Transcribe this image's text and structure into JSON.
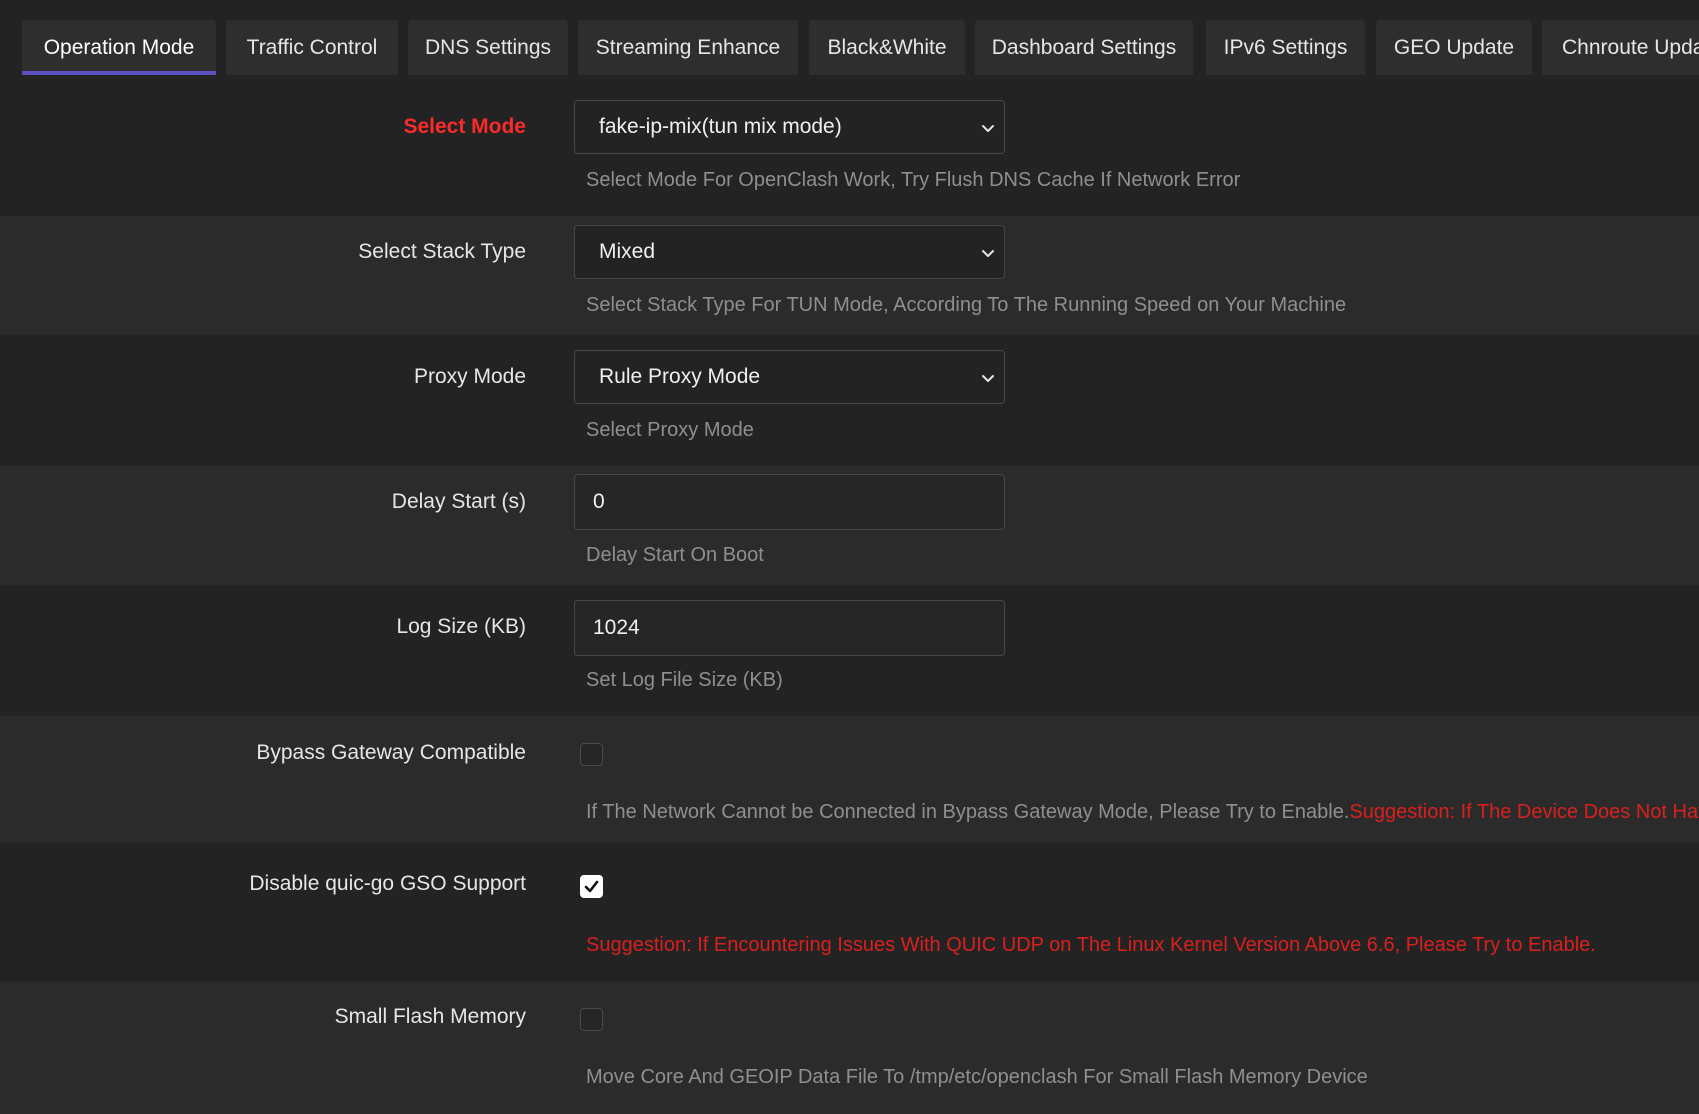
{
  "tabs": [
    {
      "label": "Operation Mode",
      "active": true
    },
    {
      "label": "Traffic Control"
    },
    {
      "label": "DNS Settings"
    },
    {
      "label": "Streaming Enhance"
    },
    {
      "label": "Black&White"
    },
    {
      "label": "Dashboard Settings"
    },
    {
      "label": "IPv6 Settings"
    },
    {
      "label": "GEO Update"
    },
    {
      "label": "Chnroute Upda"
    }
  ],
  "fields": {
    "select_mode": {
      "label": "Select Mode",
      "value": "fake-ip-mix(tun mix mode)",
      "description": "Select Mode For OpenClash Work, Try Flush DNS Cache If Network Error"
    },
    "stack_type": {
      "label": "Select Stack Type",
      "value": "Mixed",
      "description": "Select Stack Type For TUN Mode, According To The Running Speed on Your Machine"
    },
    "proxy_mode": {
      "label": "Proxy Mode",
      "value": "Rule Proxy Mode",
      "description": "Select Proxy Mode"
    },
    "delay_start": {
      "label": "Delay Start (s)",
      "value": "0",
      "description": "Delay Start On Boot"
    },
    "log_size": {
      "label": "Log Size (KB)",
      "value": "1024",
      "description": "Set Log File Size (KB)"
    },
    "bypass_gateway": {
      "label": "Bypass Gateway Compatible",
      "checked": false,
      "description": "If The Network Cannot be Connected in Bypass Gateway Mode, Please Try to Enable.",
      "suggestion": "Suggestion: If The Device Does Not Have W"
    },
    "disable_gso": {
      "label": "Disable quic-go GSO Support",
      "checked": true,
      "suggestion": "Suggestion: If Encountering Issues With QUIC UDP on The Linux Kernel Version Above 6.6, Please Try to Enable."
    },
    "small_flash": {
      "label": "Small Flash Memory",
      "checked": false,
      "description": "Move Core And GEOIP Data File To /tmp/etc/openclash For Small Flash Memory Device"
    }
  },
  "colors": {
    "accent": "#5b4fc2",
    "required_label": "#ff2a2a",
    "warning_text": "#d8201f",
    "background": "#232323",
    "row_alt": "#2b2b2b"
  }
}
